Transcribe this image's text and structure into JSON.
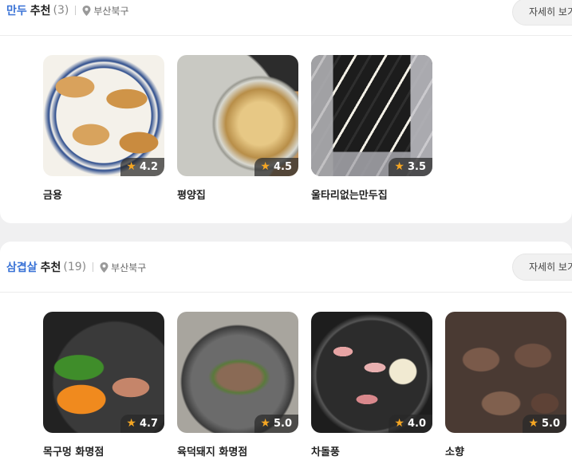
{
  "sections": [
    {
      "keyword": "만두",
      "suffix": "추천",
      "count": "(3)",
      "location": "부산북구",
      "more_label": "자세히 보기",
      "items": [
        {
          "name": "금용",
          "rating": "4.2"
        },
        {
          "name": "평양집",
          "rating": "4.5"
        },
        {
          "name": "울타리없는만두집",
          "rating": "3.5"
        }
      ]
    },
    {
      "keyword": "삼겹살",
      "suffix": "추천",
      "count": "(19)",
      "location": "부산북구",
      "more_label": "자세히 보기",
      "items": [
        {
          "name": "목구멍 화명점",
          "rating": "4.7"
        },
        {
          "name": "육덕돼지 화명점",
          "rating": "5.0"
        },
        {
          "name": "차돌풍",
          "rating": "4.0"
        },
        {
          "name": "소향",
          "rating": "5.0"
        }
      ]
    }
  ],
  "icons": {
    "location": "map-pin-icon",
    "rating": "star-icon"
  },
  "colors": {
    "keyword": "#3a73d6",
    "star": "#f5a623"
  }
}
